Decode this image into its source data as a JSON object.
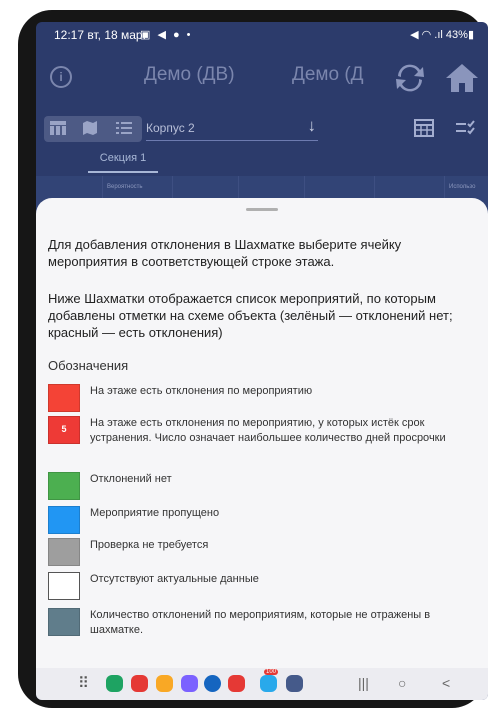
{
  "status_bar": {
    "time": "12:17",
    "date": "вт, 18 мар.",
    "notif_icons": "▣ ◀ ● •",
    "system": "◀ ◠ .ıl 43%▮"
  },
  "app_bar": {
    "title_left": "Демо (ДВ)",
    "title_right": "Демо (Д"
  },
  "toolbar": {
    "building_select": "Корпус 2",
    "view_modes": [
      "grid",
      "map",
      "list"
    ]
  },
  "tabs": [
    {
      "label": "Секция 1",
      "active": true
    }
  ],
  "table_header": {
    "col1": "Вероятность",
    "col2": "Использо"
  },
  "sheet": {
    "paragraph1": "Для добавления отклонения в Шахматке выберите ячейку мероприятия в соответствующей строке этажа.",
    "paragraph2": "Ниже Шахматки отображается список мероприятий, по которым добавлены отметки на схеме объекта (зелёный — отклонений нет; красный — есть отклонения)",
    "legend_title": "Обозначения",
    "legend": [
      {
        "color": "#f44336",
        "badge": "",
        "text": "На этаже есть отклонения по мероприятию"
      },
      {
        "color": "#ee3a36",
        "badge": "5",
        "text": "На этаже есть отклонения по мероприятию, у которых истёк срок устранения. Число означает наибольшее количество дней просрочки"
      },
      {
        "color": "#4caf50",
        "badge": "",
        "text": "Отклонений нет"
      },
      {
        "color": "#2196f3",
        "badge": "",
        "text": "Мероприятие пропущено"
      },
      {
        "color": "#9e9e9e",
        "badge": "",
        "text": "Проверка не требуется"
      },
      {
        "color": "#ffffff",
        "badge": "",
        "text": "Отсутствуют актуальные данные"
      },
      {
        "color": "#607d8b",
        "badge": "",
        "text": "Количество отклонений по мероприятиям, которые не отражены в шахматке."
      }
    ]
  },
  "nav_bar": {
    "apps": [
      {
        "name": "phone-app",
        "color": "#1ea362"
      },
      {
        "name": "messages-app",
        "color": "#e53935"
      },
      {
        "name": "notes-app",
        "color": "#f9a825"
      },
      {
        "name": "contacts-app",
        "color": "#7b61ff"
      },
      {
        "name": "chat-app",
        "color": "#1565c0"
      },
      {
        "name": "video-app",
        "color": "#e53935"
      },
      {
        "name": "telegram-app",
        "color": "#29a9eb",
        "badge": "100"
      },
      {
        "name": "settings-app",
        "color": "#455a8a"
      }
    ],
    "recent_symbol": "|||",
    "home_symbol": "○",
    "back_symbol": "<"
  }
}
